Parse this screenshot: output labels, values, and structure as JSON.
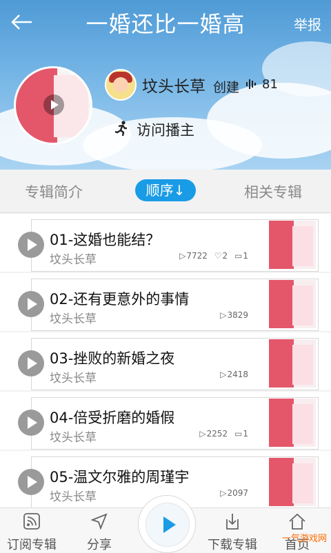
{
  "header": {
    "title": "一婚还比一婚高",
    "report_label": "举报"
  },
  "profile": {
    "author": "坟头长草",
    "created_label": "创建",
    "count": "81",
    "visit_label": "访问播主"
  },
  "tabs": [
    {
      "label": "专辑简介"
    },
    {
      "label": "顺序↓"
    },
    {
      "label": "相关专辑"
    }
  ],
  "episodes": [
    {
      "title": "01-这婚也能结？",
      "author": "坟头长草",
      "plays": "7722",
      "likes": "2",
      "comments": "1"
    },
    {
      "title": "02-还有更意外的事情",
      "author": "坟头长草",
      "plays": "3829"
    },
    {
      "title": "03-挫败的新婚之夜",
      "author": "坟头长草",
      "plays": "2418"
    },
    {
      "title": "04-倍受折磨的婚假",
      "author": "坟头长草",
      "plays": "2252",
      "comments": "1"
    },
    {
      "title": "05-温文尔雅的周瑾宇",
      "author": "坟头长草",
      "plays": "2097"
    }
  ],
  "bottom_nav": {
    "subscribe": "订阅专辑",
    "share": "分享",
    "download": "下载专辑",
    "home": "首页"
  },
  "watermark": "一气游戏网"
}
